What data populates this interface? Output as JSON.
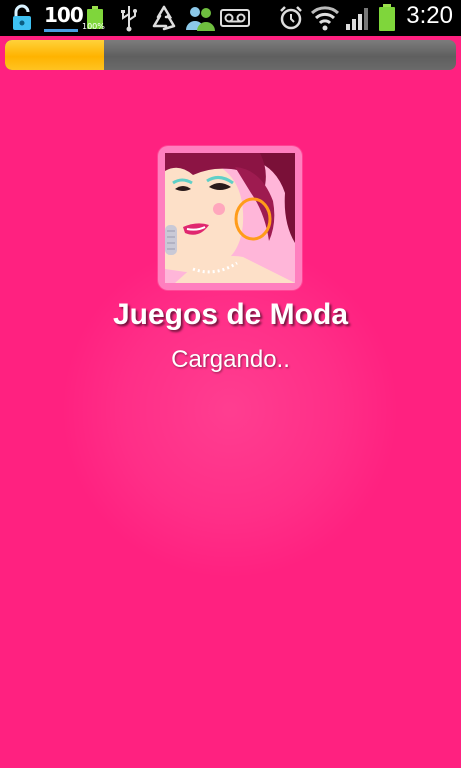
{
  "status_bar": {
    "battery_level_label": "100",
    "battery_percent_label": "100%",
    "time": "3:20",
    "icons": [
      "lock-icon",
      "battery-level-indicator",
      "battery-icon",
      "usb-icon",
      "recycle-icon",
      "people-icon",
      "voicemail-icon",
      "alarm-icon",
      "wifi-icon",
      "signal-icon",
      "battery-full-icon"
    ]
  },
  "loading": {
    "progress": 0.22
  },
  "app": {
    "title": "Juegos de Moda",
    "status": "Cargando.."
  },
  "colors": {
    "background": "#ff2180",
    "progress_fill": "#ffb300",
    "progress_track": "#6a6a6a"
  }
}
